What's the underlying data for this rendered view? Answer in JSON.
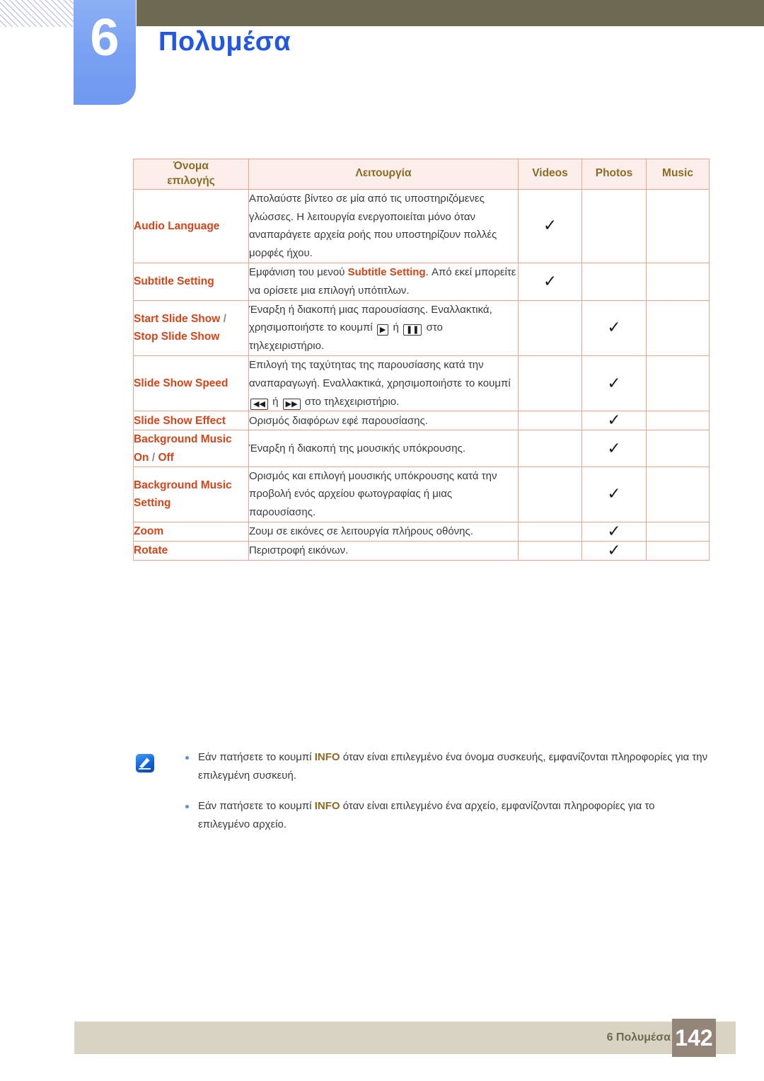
{
  "header": {
    "chapter_number": "6",
    "chapter_title": "Πολυμέσα"
  },
  "table": {
    "columns": [
      "Όνομα\nεπιλογής",
      "Λειτουργία",
      "Videos",
      "Photos",
      "Music"
    ],
    "column_headers": {
      "name_line1": "Όνομα",
      "name_line2": "επιλογής",
      "function": "Λειτουργία",
      "videos": "Videos",
      "photos": "Photos",
      "music": "Music"
    },
    "rows": [
      {
        "option": "Audio Language",
        "description": "Απολαύστε βίντεο σε μία από τις υποστηριζόμενες γλώσσες. Η λειτουργία ενεργοποιείται μόνο όταν αναπαράγετε αρχεία ροής που υποστηρίζουν πολλές μορφές ήχου.",
        "videos": "✓",
        "photos": "",
        "music": ""
      },
      {
        "option": "Subtitle Setting",
        "desc_pre": "Εμφάνιση του μενού ",
        "desc_hl": "Subtitle Setting",
        "desc_post": ". Από εκεί μπορείτε να ορίσετε μια επιλογή υπότιτλων.",
        "videos": "✓",
        "photos": "",
        "music": ""
      },
      {
        "option_pre": "Start Slide Show",
        "option_sep": " / ",
        "option_post": "Stop Slide Show",
        "desc_pre": "Έναρξη ή διακοπή μιας παρουσίασης. Εναλλακτικά, χρησιμοποιήστε το κουμπί ",
        "key1": "play-button",
        "desc_mid": " ή ",
        "key2": "pause-button",
        "desc_post": " στο τηλεχειριστήριο.",
        "videos": "",
        "photos": "✓",
        "music": ""
      },
      {
        "option": "Slide Show Speed",
        "desc_pre": "Επιλογή της ταχύτητας της παρουσίασης κατά την αναπαραγωγή. Εναλλακτικά, χρησιμοποιήστε το κουμπί ",
        "key1": "rewind-button",
        "desc_mid": " ή ",
        "key2": "fast-forward-button",
        "desc_post": " στο τηλεχειριστήριο.",
        "videos": "",
        "photos": "✓",
        "music": ""
      },
      {
        "option": "Slide Show Effect",
        "description": "Ορισμός διαφόρων εφέ παρουσίασης.",
        "videos": "",
        "photos": "✓",
        "music": ""
      },
      {
        "option_pre": "Background Music On",
        "option_sep": " / ",
        "option_post": "Off",
        "description": "Έναρξη ή διακοπή της μουσικής υπόκρουσης.",
        "videos": "",
        "photos": "✓",
        "music": ""
      },
      {
        "option": "Background Music Setting",
        "description": "Ορισμός και επιλογή μουσικής υπόκρουσης κατά την προβολή ενός αρχείου φωτογραφίας ή μιας παρουσίασης.",
        "videos": "",
        "photos": "✓",
        "music": ""
      },
      {
        "option": "Zoom",
        "description": "Ζουμ σε εικόνες σε λειτουργία πλήρους οθόνης.",
        "videos": "",
        "photos": "✓",
        "music": ""
      },
      {
        "option": "Rotate",
        "description": "Περιστροφή εικόνων.",
        "videos": "",
        "photos": "✓",
        "music": ""
      }
    ]
  },
  "note": {
    "icon": "note-pen-icon",
    "items": [
      {
        "pre": "Εάν πατήσετε το κουμπί ",
        "highlight": "INFO",
        "post": " όταν είναι επιλεγμένο ένα όνομα συσκευής, εμφανίζονται πληροφορίες για την επιλεγμένη συσκευή."
      },
      {
        "pre": "Εάν πατήσετε το κουμπί ",
        "highlight": "INFO",
        "post": " όταν είναι επιλεγμένο ένα αρχείο, εμφανίζονται πληροφορίες για το επιλεγμένο αρχείο."
      }
    ]
  },
  "footer": {
    "label": "6 Πολυμέσα",
    "page_number": "142"
  },
  "colors": {
    "chapter_title": "#2257e0",
    "chapter_tab": "#7ba2f2",
    "olive_bar": "#6e6a51",
    "table_outer_border": "#8a7a2e",
    "table_inner_border": "#e9a48d",
    "header_bg": "#fcefeb",
    "header_text": "#8a6b22",
    "option_text": "#d4451a",
    "body_text": "#3a3a3a",
    "footer_bar": "#d9d3c3",
    "footer_page_box": "#938679"
  }
}
